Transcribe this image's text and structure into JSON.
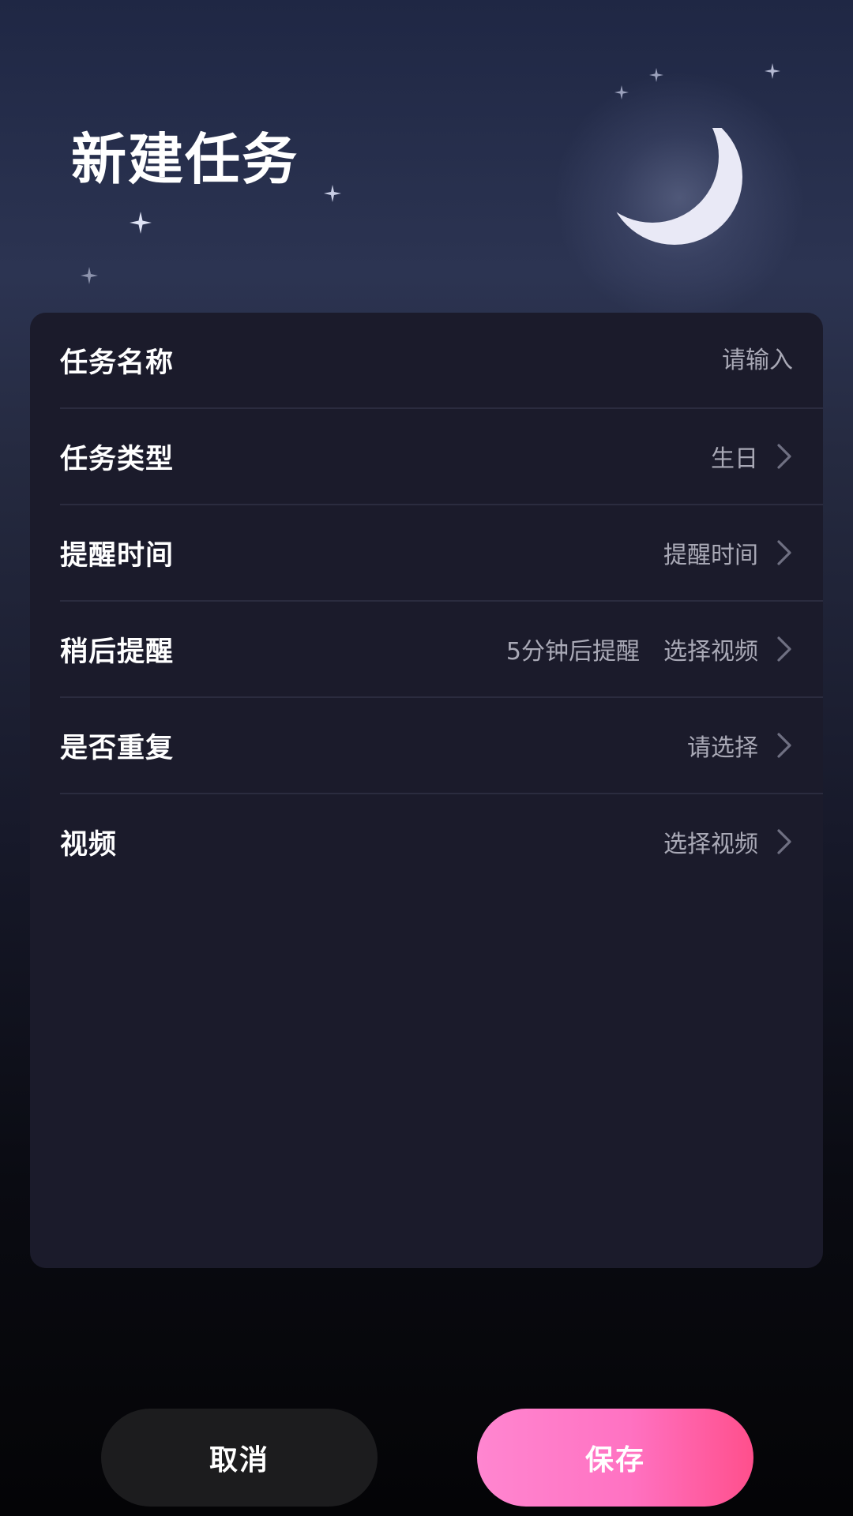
{
  "header": {
    "title": "新建任务"
  },
  "form": {
    "rows": [
      {
        "label": "任务名称",
        "placeholder": "请输入"
      },
      {
        "label": "任务类型",
        "value": "生日"
      },
      {
        "label": "提醒时间",
        "value": "提醒时间"
      },
      {
        "label": "稍后提醒",
        "extra": "5分钟后提醒",
        "value": "选择视频"
      },
      {
        "label": "是否重复",
        "value": "请选择"
      },
      {
        "label": "视频",
        "value": "选择视频"
      }
    ]
  },
  "actions": {
    "cancel_label": "取消",
    "save_label": "保存"
  },
  "icons": {
    "row_arrow": "chevron-right-icon",
    "decoration": [
      "moon-icon",
      "star-icon"
    ]
  },
  "colors": {
    "card_background": "#1b1b2b",
    "label_text": "#ffffff",
    "value_text": "#a9a9b6",
    "save_gradient_start": "#ff86d0",
    "save_gradient_end": "#ff4f8c",
    "cancel_background": "#1c1c1e"
  }
}
